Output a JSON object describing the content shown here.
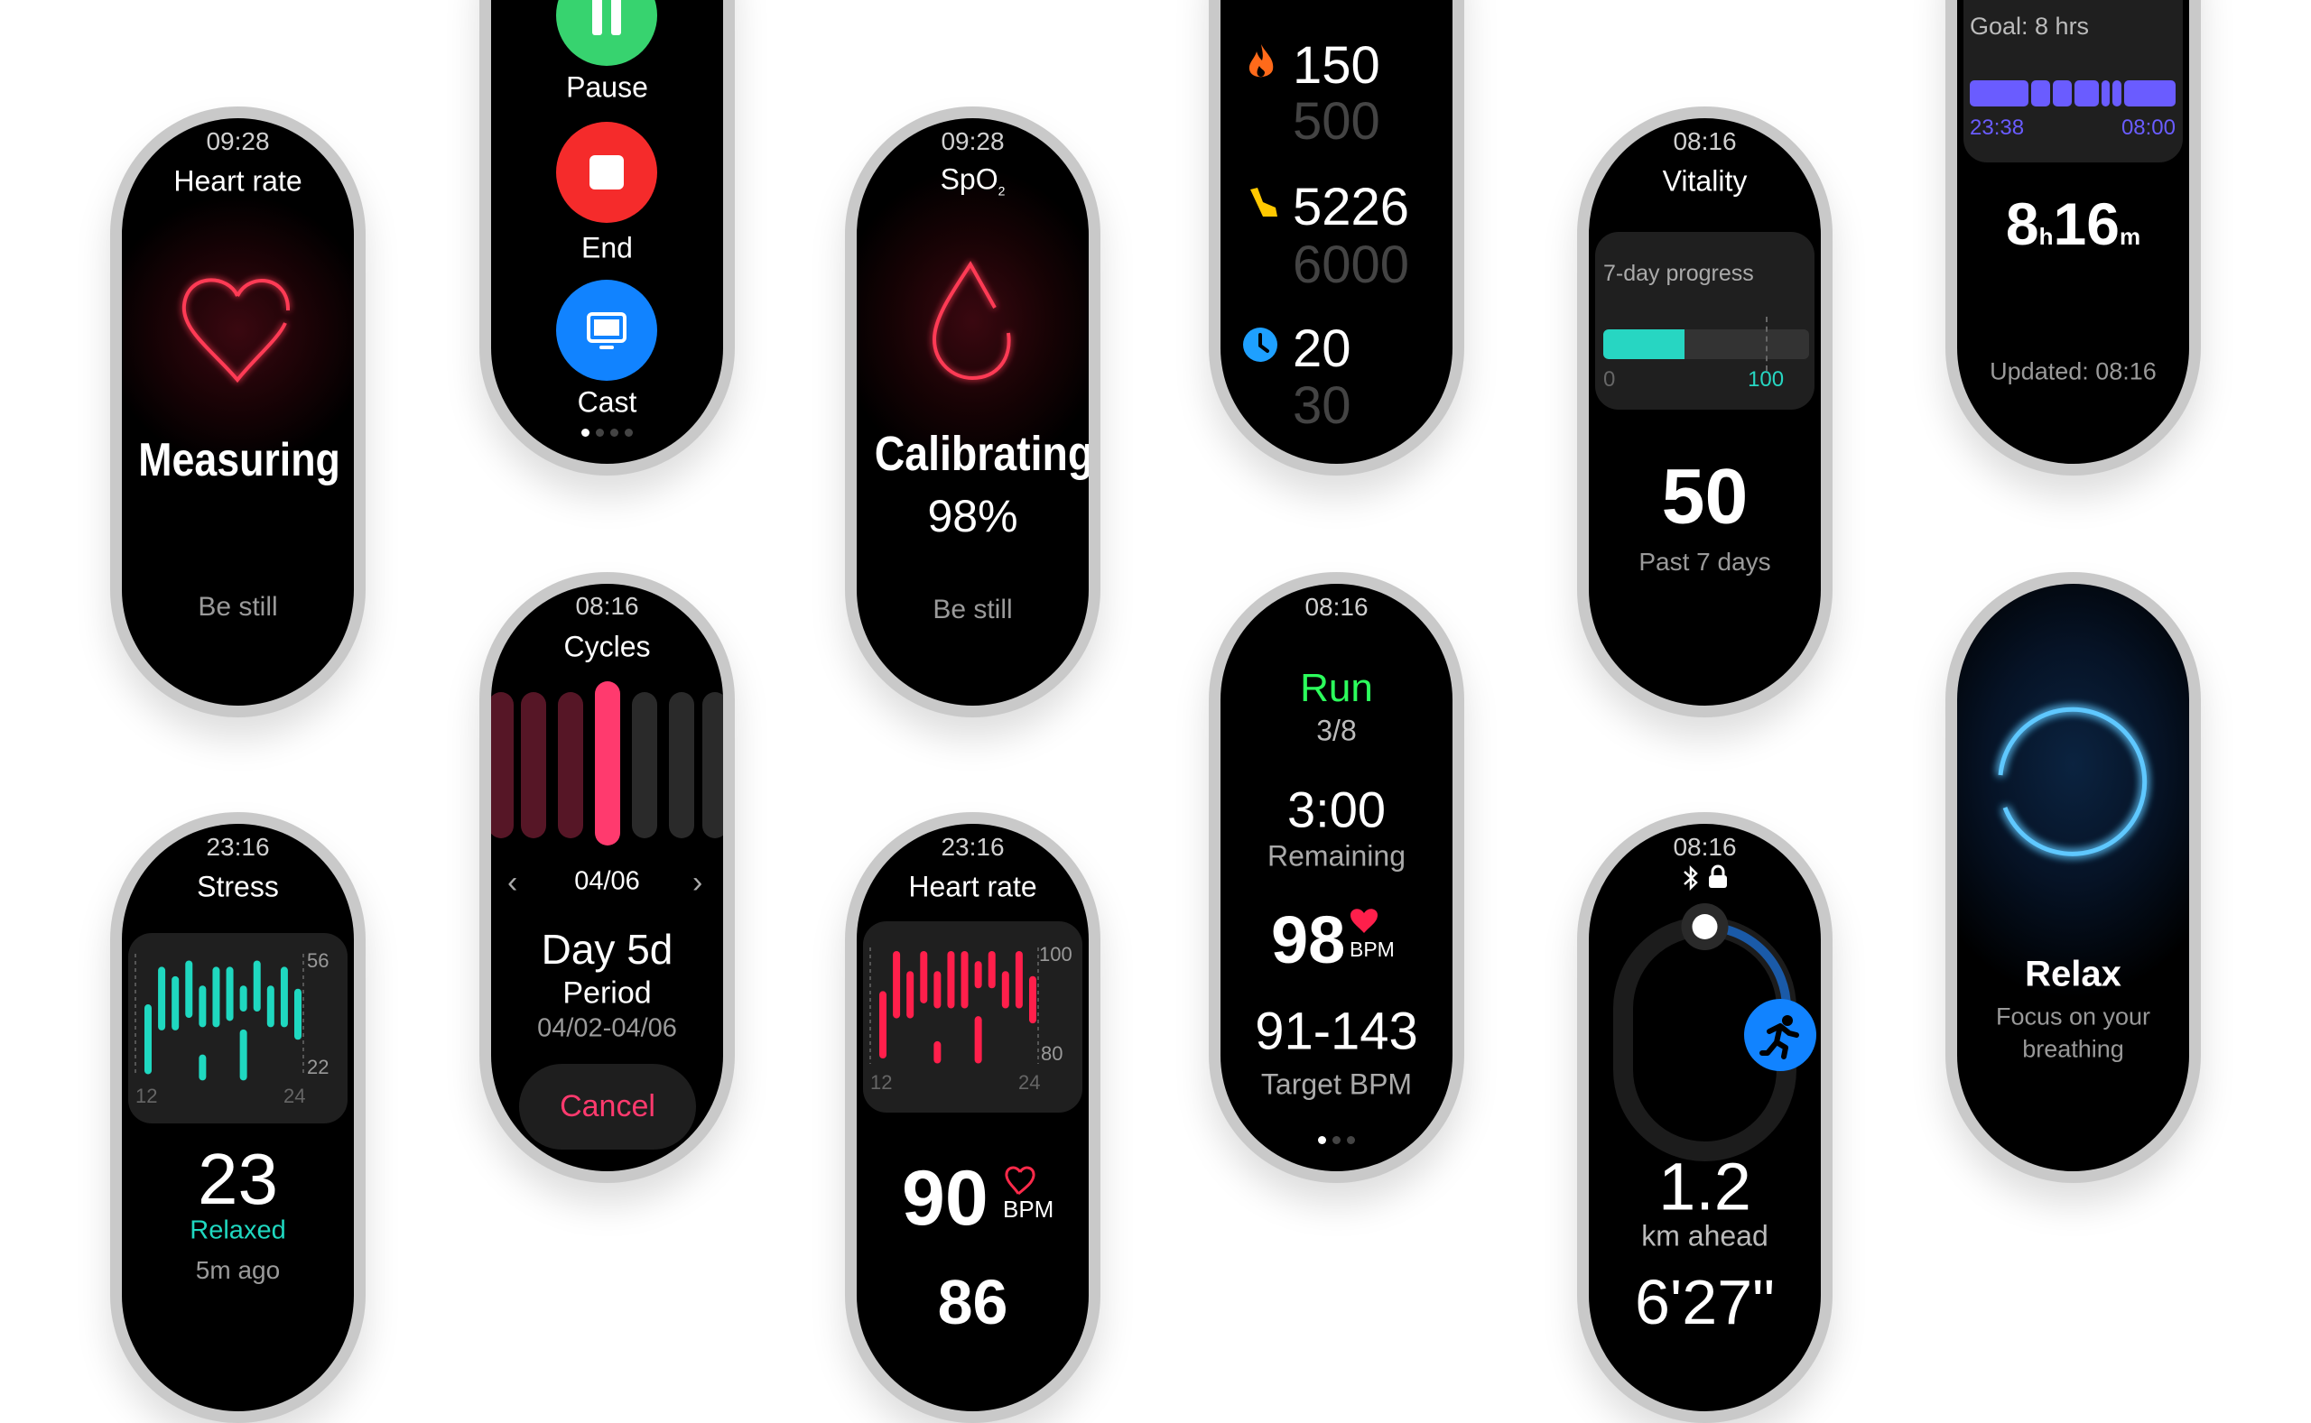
{
  "screens": {
    "heart_measure": {
      "time": "09:28",
      "title": "Heart rate",
      "status": "Measuring",
      "hint": "Be still"
    },
    "workout_controls": {
      "pause": "Pause",
      "end": "End",
      "cast": "Cast",
      "page_count": 4,
      "page_active": 0,
      "colors": {
        "pause": "#37d36f",
        "end": "#f52b2b",
        "cast": "#1183ff"
      }
    },
    "spo2": {
      "time": "09:28",
      "title": "SpO",
      "title_sub": "2",
      "status": "Calibrating",
      "progress": "98%",
      "hint": "Be still"
    },
    "activity": {
      "rows": [
        {
          "icon": "flame-icon",
          "value": "150",
          "goal": "500",
          "color": "#ff6a1a"
        },
        {
          "icon": "steps-icon",
          "value": "5226",
          "goal": "6000",
          "color": "#ffc800"
        },
        {
          "icon": "clock-icon",
          "value": "20",
          "goal": "30",
          "color": "#1ea0ff"
        }
      ]
    },
    "vitality": {
      "time": "08:16",
      "title": "Vitality",
      "card_label": "7-day progress",
      "min_label": "0",
      "target_label": "100",
      "value": 50,
      "target": 100,
      "value_text": "50",
      "caption": "Past 7 days",
      "accent": "#27d6c2"
    },
    "sleep": {
      "goal": "Goal: 8 hrs",
      "start": "23:38",
      "end": "08:00",
      "hours": "8",
      "h_unit": "h",
      "minutes": "16",
      "m_unit": "m",
      "updated": "Updated: 08:16",
      "accent": "#6a5cff"
    },
    "stress": {
      "time": "23:16",
      "title": "Stress",
      "value": "23",
      "level": "Relaxed",
      "ago": "5m ago",
      "accent": "#1fd8c0",
      "chart": {
        "y_max_label": "56",
        "y_min_label": "22",
        "x_start": "12",
        "x_end": "24",
        "ylim": [
          22,
          56
        ],
        "bars": [
          [
            [
              21,
              41
            ]
          ],
          [
            [
              35,
              53
            ]
          ],
          [
            [
              35,
              50
            ]
          ],
          [
            [
              39,
              55
            ]
          ],
          [
            [
              36,
              47
            ],
            [
              19,
              25
            ]
          ],
          [
            [
              36,
              53
            ]
          ],
          [
            [
              38,
              53
            ]
          ],
          [
            [
              41,
              47
            ],
            [
              19,
              33
            ]
          ],
          [
            [
              41,
              55
            ]
          ],
          [
            [
              36,
              47
            ]
          ],
          [
            [
              36,
              53
            ]
          ],
          [
            [
              32,
              46
            ]
          ]
        ]
      }
    },
    "cycles": {
      "time": "08:16",
      "title": "Cycles",
      "date": "04/06",
      "day": "Day 5d",
      "phase": "Period",
      "range": "04/02-04/06",
      "cancel": "Cancel",
      "days": [
        "period",
        "period",
        "period",
        "selected",
        "none",
        "none",
        "none"
      ],
      "accent": "#ff3a6e"
    },
    "heart_rate": {
      "time": "23:16",
      "title": "Heart rate",
      "bpm": "90",
      "bpm_unit": "BPM",
      "next_value": "86",
      "accent": "#ff1f4b",
      "chart": {
        "y_max_label": "100",
        "y_min_label": "80",
        "x_start": "12",
        "x_end": "24",
        "ylim": [
          80,
          100
        ],
        "bars": [
          [
            [
              80,
              92
            ]
          ],
          [
            [
              88,
              100
            ]
          ],
          [
            [
              88,
              96
            ]
          ],
          [
            [
              91,
              100
            ]
          ],
          [
            [
              90,
              96
            ],
            [
              79,
              82
            ]
          ],
          [
            [
              90,
              100
            ]
          ],
          [
            [
              90,
              100
            ]
          ],
          [
            [
              94,
              98
            ],
            [
              79,
              87
            ]
          ],
          [
            [
              94,
              100
            ]
          ],
          [
            [
              90,
              96
            ]
          ],
          [
            [
              90,
              100
            ]
          ],
          [
            [
              87,
              95
            ]
          ]
        ]
      }
    },
    "run_interval": {
      "time": "08:16",
      "activity": "Run",
      "step": "3/8",
      "remaining_value": "3:00",
      "remaining_label": "Remaining",
      "bpm": "98",
      "bpm_unit": "BPM",
      "target": "91-143",
      "target_label": "Target BPM",
      "page_count": 3,
      "page_active": 0,
      "accent": "#2cff5c"
    },
    "pace": {
      "time": "08:16",
      "distance": "1.2",
      "distance_label": "km ahead",
      "pace": "6'27\"",
      "ahead_progress": 0.25
    },
    "relax": {
      "title": "Relax",
      "line1": "Focus on your",
      "line2": "breathing",
      "accent": "#1e8fff"
    }
  }
}
